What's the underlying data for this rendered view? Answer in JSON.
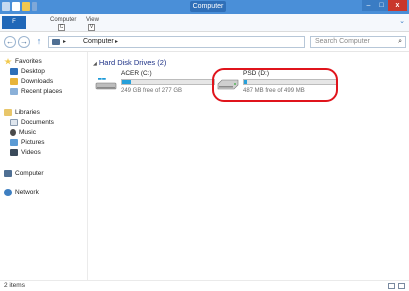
{
  "window": {
    "title": "Computer",
    "controls": {
      "minimize": "–",
      "maximize": "□",
      "close": "x"
    }
  },
  "ribbon": {
    "file_tab": "F",
    "tabs": [
      {
        "label": "Computer",
        "key_tip": "C"
      },
      {
        "label": "View",
        "key_tip": "V"
      }
    ],
    "expand_icon": "chevron-down-icon"
  },
  "address_bar": {
    "path_separator": "▸",
    "location": "Computer",
    "trailing_separator": "▸",
    "dropdown": "▾",
    "refresh": "↻"
  },
  "search": {
    "placeholder": "Search Computer",
    "icon": "search-icon"
  },
  "navigation": {
    "favorites": {
      "label": "Favorites",
      "items": [
        "Desktop",
        "Downloads",
        "Recent places"
      ]
    },
    "libraries": {
      "label": "Libraries",
      "items": [
        "Documents",
        "Music",
        "Pictures",
        "Videos"
      ]
    },
    "computer": "Computer",
    "network": "Network"
  },
  "content": {
    "group_title": "Hard Disk Drives (2)",
    "drives": [
      {
        "name": "ACER (C:)",
        "free_text": "249 GB free of 277 GB",
        "used_fraction": 0.1,
        "icon": "windows-drive-icon"
      },
      {
        "name": "PSD (D:)",
        "free_text": "487 MB free of 499 MB",
        "used_fraction": 0.03,
        "icon": "hard-drive-icon"
      }
    ]
  },
  "status": {
    "item_count": "2 items"
  },
  "colors": {
    "titlebar": "#4a8fd8",
    "accent": "#26a0da",
    "highlight_ring": "#e0141c",
    "group_heading": "#1e3287"
  }
}
